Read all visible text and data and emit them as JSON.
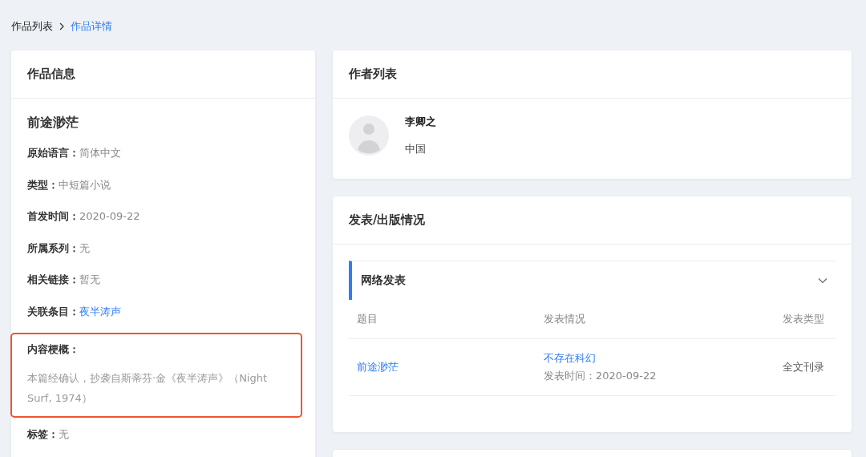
{
  "breadcrumb": [
    {
      "label": "作品列表",
      "selected": false
    },
    {
      "label": "作品详情",
      "selected": true
    }
  ],
  "work_info": {
    "title": "作品信息",
    "work_title": "前途渺茫",
    "fields": [
      {
        "label": "原始语言：",
        "value": "简体中文",
        "kind": "text",
        "highlighted": false
      },
      {
        "label": "类型：",
        "value": "中短篇小说",
        "kind": "text",
        "highlighted": false
      },
      {
        "label": "首发时间：",
        "value": "2020-09-22",
        "kind": "text",
        "highlighted": false
      },
      {
        "label": "所属系列：",
        "value": "无",
        "kind": "text",
        "highlighted": false
      },
      {
        "label": "相关链接：",
        "value": "暂无",
        "kind": "text",
        "highlighted": false
      },
      {
        "label": "关联条目：",
        "value": "夜半涛声",
        "kind": "link",
        "highlighted": false
      },
      {
        "label": "内容梗概：",
        "value": "本篇经确认，抄袭自斯蒂芬·金《夜半涛声》（Night Surf, 1974）",
        "kind": "block",
        "highlighted": true
      },
      {
        "label": "标签：",
        "value": "无",
        "kind": "text",
        "highlighted": false
      }
    ]
  },
  "authors": {
    "title": "作者列表",
    "items": [
      {
        "name": "李卿之",
        "country": "中国"
      }
    ]
  },
  "publication": {
    "title": "发表/出版情况",
    "section": {
      "title": "网络发表",
      "expanded": true,
      "columns": [
        "题目",
        "发表情况",
        "发表类型"
      ],
      "rows": [
        {
          "title": "前途渺茫",
          "venue": "不存在科幻",
          "date": "发表时间：2020-09-22",
          "type": "全文刊录"
        }
      ]
    }
  }
}
